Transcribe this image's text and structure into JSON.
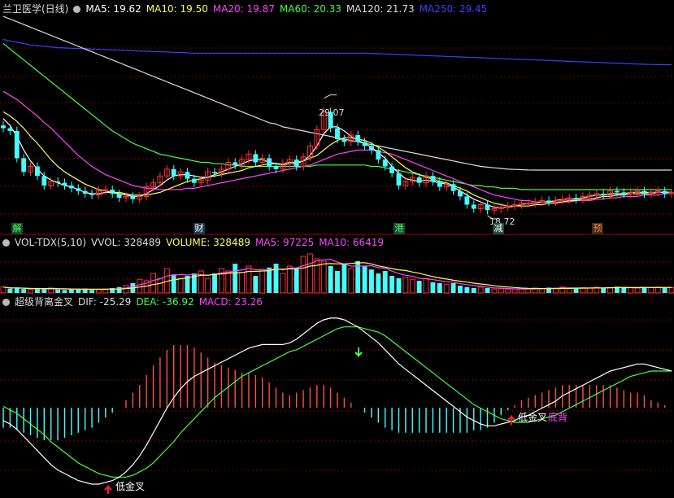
{
  "header": {
    "stock_title": "兰卫医学(日线)",
    "ma": [
      {
        "label": "MA5: 19.62",
        "color": "#ffffff"
      },
      {
        "label": "MA10: 19.50",
        "color": "#ffff55"
      },
      {
        "label": "MA20: 19.87",
        "color": "#ff44ff"
      },
      {
        "label": "MA60: 20.33",
        "color": "#44ff44"
      },
      {
        "label": "MA120: 21.73",
        "color": "#dddddd"
      },
      {
        "label": "MA250: 29.45",
        "color": "#3344ff"
      }
    ]
  },
  "vol_header": {
    "title": "VOL-TDX(5,10)",
    "items": [
      {
        "label": "VVOL: 328489",
        "color": "#dddddd"
      },
      {
        "label": "VOLUME: 328489",
        "color": "#ffff55"
      },
      {
        "label": "MA5: 97225",
        "color": "#ff44ff"
      },
      {
        "label": "MA10: 66419",
        "color": "#ff44ff"
      }
    ]
  },
  "macd_header": {
    "title": "超级背离金叉",
    "items": [
      {
        "label": "DIF: -25.29",
        "color": "#dddddd"
      },
      {
        "label": "DEA: -36.92",
        "color": "#44ff44"
      },
      {
        "label": "MACD: 23.26",
        "color": "#ff44ff"
      }
    ]
  },
  "annotations": {
    "high": "29.07",
    "low": "18.72",
    "cross1": "低金叉",
    "cross2": "低金叉",
    "divergence": "底背"
  },
  "event_markers": [
    {
      "label": "解",
      "color": "#44ff44",
      "bg": "#1a4a3a"
    },
    {
      "label": "财",
      "color": "#ffffff",
      "bg": "#1a3a4a"
    },
    {
      "label": "港",
      "color": "#44ff44",
      "bg": "#1a4a3a"
    },
    {
      "label": "减",
      "color": "#ffffff",
      "bg": "#1a4a3a"
    },
    {
      "label": "预",
      "color": "#ff8844",
      "bg": "#3a2a1a"
    }
  ],
  "chart_data": {
    "type": "candlestick",
    "note_price_range": [
      17.5,
      33
    ],
    "closes": [
      24.8,
      24.6,
      22.6,
      21.6,
      22.0,
      21.3,
      20.6,
      20.9,
      20.8,
      20.6,
      20.4,
      20.2,
      20.0,
      19.9,
      20.2,
      20.3,
      20.0,
      19.7,
      19.8,
      19.6,
      19.8,
      20.5,
      20.8,
      21.3,
      21.8,
      21.3,
      21.6,
      21.1,
      20.8,
      21.0,
      21.6,
      21.5,
      21.8,
      22.3,
      22.1,
      22.5,
      22.9,
      22.3,
      22.6,
      22.0,
      21.8,
      22.2,
      22.5,
      22.0,
      22.7,
      23.5,
      24.7,
      26.0,
      24.8,
      24.0,
      23.8,
      24.3,
      23.8,
      23.5,
      23.2,
      22.5,
      22.0,
      21.5,
      20.6,
      20.9,
      21.2,
      20.8,
      21.3,
      20.9,
      20.5,
      20.7,
      20.2,
      19.8,
      19.2,
      18.9,
      19.2,
      18.8,
      18.9,
      19.0,
      19.1,
      19.2,
      19.3,
      19.3,
      19.4,
      19.5,
      19.4,
      19.5,
      19.6,
      19.7,
      19.6,
      19.8,
      19.9,
      20.0,
      19.9,
      20.2,
      20.1,
      20.0,
      20.1,
      20.2,
      20.0,
      20.1,
      20.2,
      20.0,
      20.1
    ],
    "ma5": [
      25.5,
      25.0,
      24.2,
      23.2,
      22.4,
      21.8,
      21.3,
      21.0,
      20.8,
      20.6,
      20.5,
      20.3,
      20.1,
      20.0,
      20.0,
      20.1,
      20.1,
      20.0,
      19.9,
      19.8,
      19.8,
      20.0,
      20.3,
      20.6,
      21.0,
      21.3,
      21.4,
      21.4,
      21.3,
      21.2,
      21.2,
      21.4,
      21.6,
      21.8,
      22.0,
      22.2,
      22.4,
      22.5,
      22.5,
      22.3,
      22.2,
      22.1,
      22.2,
      22.2,
      22.4,
      22.8,
      23.5,
      24.4,
      24.9,
      24.9,
      24.6,
      24.2,
      23.9,
      23.7,
      23.4,
      23.0,
      22.6,
      22.0,
      21.5,
      21.1,
      21.0,
      20.9,
      21.0,
      20.9,
      20.8,
      20.7,
      20.5,
      20.2,
      19.9,
      19.6,
      19.4,
      19.2,
      19.0,
      19.0,
      19.0,
      19.1,
      19.2,
      19.3,
      19.3,
      19.4,
      19.4,
      19.5,
      19.6,
      19.6,
      19.6,
      19.7,
      19.8,
      19.9,
      19.9,
      20.0,
      20.0,
      20.0,
      20.1,
      20.1,
      20.1,
      20.1,
      20.1,
      20.1,
      20.1
    ],
    "ma10": [
      26.0,
      25.7,
      25.3,
      24.8,
      24.2,
      23.7,
      23.1,
      22.5,
      22.0,
      21.6,
      21.3,
      21.0,
      20.7,
      20.5,
      20.3,
      20.2,
      20.1,
      20.1,
      20.0,
      19.9,
      19.9,
      19.9,
      20.0,
      20.1,
      20.3,
      20.5,
      20.7,
      20.9,
      21.0,
      21.1,
      21.2,
      21.3,
      21.4,
      21.5,
      21.6,
      21.7,
      21.9,
      22.0,
      22.1,
      22.2,
      22.2,
      22.2,
      22.3,
      22.3,
      22.4,
      22.6,
      22.8,
      23.2,
      23.6,
      23.9,
      24.1,
      24.1,
      24.0,
      23.9,
      23.7,
      23.4,
      23.1,
      22.7,
      22.3,
      21.9,
      21.6,
      21.4,
      21.2,
      21.1,
      20.9,
      20.8,
      20.6,
      20.4,
      20.2,
      19.9,
      19.7,
      19.5,
      19.3,
      19.2,
      19.1,
      19.1,
      19.1,
      19.1,
      19.2,
      19.2,
      19.3,
      19.3,
      19.4,
      19.5,
      19.5,
      19.6,
      19.6,
      19.7,
      19.8,
      19.8,
      19.9,
      19.9,
      20.0,
      20.0,
      20.0,
      20.0,
      20.1,
      20.1,
      20.1
    ],
    "ma20": [
      27.5,
      27.2,
      26.9,
      26.5,
      26.1,
      25.7,
      25.2,
      24.8,
      24.3,
      23.8,
      23.3,
      22.8,
      22.4,
      22.0,
      21.7,
      21.4,
      21.2,
      21.0,
      20.8,
      20.6,
      20.5,
      20.4,
      20.4,
      20.3,
      20.3,
      20.3,
      20.3,
      20.4,
      20.4,
      20.5,
      20.6,
      20.7,
      20.8,
      20.9,
      21.0,
      21.1,
      21.2,
      21.3,
      21.4,
      21.5,
      21.6,
      21.7,
      21.8,
      21.9,
      22.0,
      22.1,
      22.3,
      22.5,
      22.7,
      22.9,
      23.0,
      23.1,
      23.2,
      23.2,
      23.2,
      23.1,
      23.0,
      22.9,
      22.7,
      22.5,
      22.3,
      22.1,
      21.9,
      21.7,
      21.5,
      21.3,
      21.1,
      20.9,
      20.7,
      20.5,
      20.3,
      20.1,
      19.9,
      19.8,
      19.7,
      19.6,
      19.5,
      19.5,
      19.4,
      19.4,
      19.4,
      19.4,
      19.4,
      19.4,
      19.5,
      19.5,
      19.5,
      19.6,
      19.6,
      19.7,
      19.7,
      19.8,
      19.8,
      19.8,
      19.9,
      19.9,
      19.9,
      20.0,
      20.0
    ],
    "ma60": [
      31.0,
      30.6,
      30.2,
      29.8,
      29.4,
      29.0,
      28.6,
      28.2,
      27.8,
      27.4,
      27.0,
      26.6,
      26.2,
      25.8,
      25.4,
      25.0,
      24.6,
      24.3,
      24.0,
      23.7,
      23.5,
      23.3,
      23.1,
      22.9,
      22.8,
      22.7,
      22.6,
      22.5,
      22.4,
      22.3,
      22.3,
      22.2,
      22.2,
      22.1,
      22.1,
      22.0,
      22.0,
      22.0,
      22.0,
      22.0,
      22.0,
      22.0,
      22.0,
      22.0,
      22.0,
      22.0,
      22.1,
      22.1,
      22.1,
      22.1,
      22.1,
      22.1,
      22.1,
      22.1,
      22.0,
      22.0,
      21.9,
      21.8,
      21.7,
      21.6,
      21.5,
      21.4,
      21.3,
      21.2,
      21.1,
      21.0,
      20.9,
      20.8,
      20.7,
      20.6,
      20.6,
      20.5,
      20.5,
      20.4,
      20.4,
      20.4,
      20.3,
      20.3,
      20.3,
      20.3,
      20.3,
      20.3,
      20.3,
      20.3,
      20.3,
      20.3,
      20.3,
      20.3,
      20.3,
      20.3,
      20.3,
      20.3,
      20.3,
      20.3,
      20.3,
      20.3,
      20.3,
      20.3,
      20.3
    ],
    "ma120": [
      33.0,
      32.8,
      32.6,
      32.4,
      32.2,
      32.0,
      31.8,
      31.6,
      31.4,
      31.2,
      31.0,
      30.8,
      30.6,
      30.4,
      30.2,
      30.0,
      29.8,
      29.6,
      29.4,
      29.2,
      29.0,
      28.8,
      28.6,
      28.4,
      28.2,
      28.0,
      27.8,
      27.6,
      27.4,
      27.2,
      27.0,
      26.8,
      26.6,
      26.4,
      26.2,
      26.0,
      25.8,
      25.6,
      25.4,
      25.2,
      25.1,
      24.9,
      24.8,
      24.7,
      24.6,
      24.5,
      24.4,
      24.3,
      24.2,
      24.1,
      24.0,
      23.9,
      23.8,
      23.7,
      23.6,
      23.5,
      23.4,
      23.3,
      23.2,
      23.1,
      23.0,
      22.9,
      22.8,
      22.7,
      22.6,
      22.5,
      22.4,
      22.3,
      22.2,
      22.1,
      22.0,
      21.95,
      21.9,
      21.85,
      21.8,
      21.78,
      21.76,
      21.74,
      21.73,
      21.73,
      21.73,
      21.73,
      21.73,
      21.73,
      21.73,
      21.73,
      21.73,
      21.73,
      21.73,
      21.73,
      21.73,
      21.73,
      21.73,
      21.73,
      21.73,
      21.73,
      21.73,
      21.73,
      21.73
    ],
    "ma250": [
      31.3,
      31.2,
      31.1,
      31.0,
      30.9,
      30.85,
      30.8,
      30.75,
      30.7,
      30.68,
      30.66,
      30.64,
      30.62,
      30.6,
      30.58,
      30.56,
      30.54,
      30.52,
      30.5,
      30.48,
      30.46,
      30.44,
      30.42,
      30.4,
      30.38,
      30.36,
      30.34,
      30.32,
      30.3,
      30.3,
      30.3,
      30.3,
      30.3,
      30.3,
      30.3,
      30.3,
      30.3,
      30.3,
      30.3,
      30.3,
      30.3,
      30.3,
      30.3,
      30.3,
      30.3,
      30.3,
      30.3,
      30.3,
      30.3,
      30.3,
      30.3,
      30.3,
      30.3,
      30.3,
      30.28,
      30.26,
      30.24,
      30.22,
      30.2,
      30.18,
      30.16,
      30.14,
      30.12,
      30.1,
      30.08,
      30.06,
      30.04,
      30.02,
      30.0,
      29.98,
      29.96,
      29.94,
      29.92,
      29.9,
      29.88,
      29.86,
      29.84,
      29.82,
      29.8,
      29.78,
      29.76,
      29.74,
      29.72,
      29.7,
      29.68,
      29.66,
      29.64,
      29.62,
      29.6,
      29.58,
      29.56,
      29.54,
      29.52,
      29.5,
      29.48,
      29.47,
      29.46,
      29.45,
      29.45
    ],
    "volume": [
      0.12,
      0.09,
      0.1,
      0.08,
      0.07,
      0.09,
      0.08,
      0.1,
      0.07,
      0.06,
      0.08,
      0.07,
      0.09,
      0.06,
      0.07,
      0.08,
      0.1,
      0.12,
      0.15,
      0.2,
      0.28,
      0.25,
      0.4,
      0.3,
      0.5,
      0.38,
      0.3,
      0.35,
      0.4,
      0.45,
      0.3,
      0.4,
      0.5,
      0.45,
      0.6,
      0.42,
      0.55,
      0.35,
      0.48,
      0.52,
      0.6,
      0.4,
      0.55,
      0.5,
      0.75,
      0.8,
      0.7,
      0.65,
      0.55,
      0.45,
      0.6,
      0.5,
      0.65,
      0.55,
      0.48,
      0.4,
      0.45,
      0.35,
      0.3,
      0.32,
      0.28,
      0.25,
      0.3,
      0.22,
      0.2,
      0.18,
      0.2,
      0.15,
      0.12,
      0.1,
      0.12,
      0.1,
      0.08,
      0.09,
      0.07,
      0.08,
      0.09,
      0.08,
      0.1,
      0.09,
      0.11,
      0.1,
      0.12,
      0.1,
      0.09,
      0.11,
      0.1,
      0.12,
      0.1,
      0.11,
      0.13,
      0.12,
      0.11,
      0.1,
      0.12,
      0.11,
      0.12,
      0.1,
      0.11
    ],
    "dif": [
      -28,
      -30,
      -33,
      -37,
      -41,
      -45,
      -49,
      -53,
      -56,
      -58,
      -60,
      -62,
      -63,
      -64,
      -64,
      -63,
      -62,
      -60,
      -57,
      -53,
      -48,
      -42,
      -35,
      -28,
      -21,
      -15,
      -10,
      -6,
      -3,
      -1,
      1,
      3,
      5,
      7,
      9,
      11,
      13,
      14,
      15,
      15,
      15,
      15,
      16,
      18,
      21,
      24,
      27,
      29,
      30,
      30,
      29,
      27,
      25,
      22,
      19,
      16,
      12,
      8,
      4,
      1,
      -2,
      -5,
      -8,
      -11,
      -14,
      -17,
      -20,
      -23,
      -26,
      -28,
      -30,
      -31,
      -31,
      -30,
      -29,
      -28,
      -26,
      -25,
      -23,
      -21,
      -19,
      -17,
      -14,
      -12,
      -10,
      -8,
      -6,
      -4,
      -2,
      0,
      1,
      2,
      3,
      4,
      4,
      3,
      2,
      1,
      0
    ],
    "dea": [
      -20,
      -22,
      -24,
      -27,
      -30,
      -33,
      -36,
      -40,
      -43,
      -46,
      -49,
      -52,
      -54,
      -56,
      -58,
      -59,
      -60,
      -60,
      -60,
      -59,
      -57,
      -55,
      -52,
      -48,
      -44,
      -40,
      -35,
      -31,
      -27,
      -23,
      -19,
      -15,
      -12,
      -9,
      -6,
      -3,
      -1,
      1,
      3,
      5,
      7,
      9,
      11,
      12,
      14,
      16,
      18,
      20,
      22,
      24,
      25,
      25,
      25,
      24,
      23,
      22,
      20,
      17,
      14,
      11,
      8,
      5,
      2,
      -1,
      -4,
      -7,
      -10,
      -13,
      -16,
      -19,
      -21,
      -23,
      -25,
      -27,
      -28,
      -29,
      -29,
      -29,
      -28,
      -27,
      -26,
      -25,
      -23,
      -21,
      -19,
      -17,
      -15,
      -13,
      -11,
      -9,
      -7,
      -5,
      -3,
      -2,
      -1,
      0,
      0,
      0,
      0
    ]
  }
}
